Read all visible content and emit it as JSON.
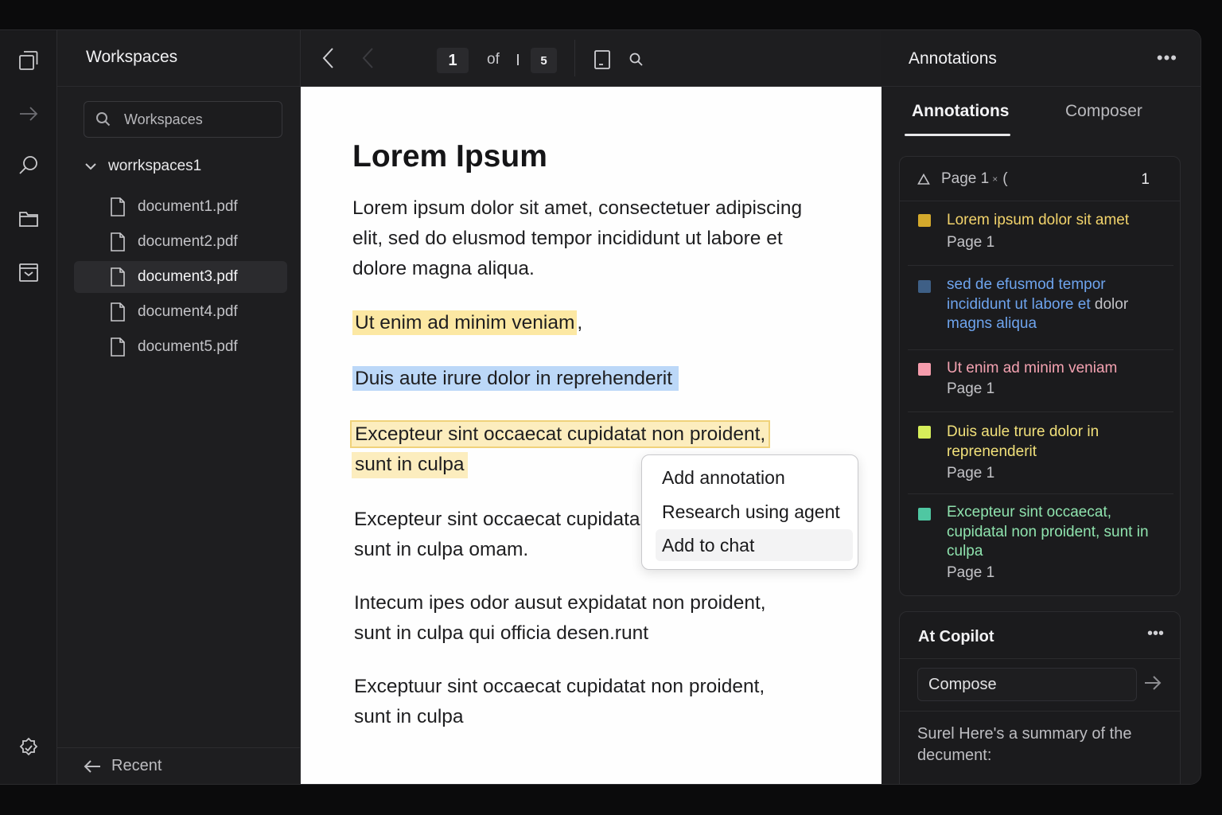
{
  "rail": {
    "icons": [
      "copy-icon",
      "arrow-right-icon",
      "search-icon",
      "folder-icon",
      "inbox-icon",
      "settings-icon"
    ]
  },
  "sidebar": {
    "title": "Workspaces",
    "search_placeholder": "Workspaces",
    "folder": "worrkspaces1",
    "files": [
      "document1.pdf",
      "document2.pdf",
      "document3.pdf",
      "document4.pdf",
      "document5.pdf"
    ],
    "active_file": "document3.pdf",
    "footer": "Recent"
  },
  "toolbar": {
    "current_page": "1",
    "of_label": "of",
    "total_pages": "5"
  },
  "document": {
    "title": "Lorem Ipsum",
    "p1": "Lorem ipsum dolor sit amet, consectetuer adipiscing elit, sed do elusmod tempor incididunt ut labore et dolore magna aliqua.",
    "hl_yellow": "Ut enim ad minim veniam",
    "hl_yellow_tail": ",",
    "hl_blue": "Duis aute irure dolor in reprehenderit",
    "hl_cream_1": "Excepteur sint occaecat cupidatat non proident,",
    "hl_cream_2": "sunt in culpa",
    "p4_line1": "Excepteur sint occaecat cupidata",
    "p4_line2": "sunt in culpa omam.",
    "p5_line1": "Intecum ipes odor ausut expidatat non proident,",
    "p5_line2": "sunt in culpa qui officia desen.runt",
    "p6_line1": "Exceptuur sint occaecat cupidatat non proident,",
    "p6_line2": "sunt in culpa"
  },
  "context_menu": {
    "items": [
      "Add annotation",
      "Research using agent",
      "Add to chat"
    ],
    "hovered": "Add to chat"
  },
  "right_panel": {
    "title": "Annotations",
    "menu_glyph": "•••",
    "tabs": [
      "Annotations",
      "Composer"
    ],
    "active_tab": "Annotations",
    "filter": {
      "label": "Page 1",
      "small": "×",
      "trail": "(",
      "count": "1"
    },
    "annotations": [
      {
        "color": "#d4a92c",
        "text": "Lorem ipsum dolor sit amet",
        "text_color": "#f2d36b",
        "page": "Page 1"
      },
      {
        "color": "#3e5f86",
        "text_a": "sed de efusmod tempor incididunt ut labore et",
        "text_b": "dolor",
        "text_c": "magns aliqua",
        "text_color": "#6ea4ee",
        "page": ""
      },
      {
        "color": "#f59cac",
        "text": "Ut enim ad minim veniam",
        "text_color": "#f4a2b1",
        "page": "Page 1"
      },
      {
        "color": "#d6ee5a",
        "text": "Duis aule trure dolor in reprenenderit",
        "text_color": "#f1e07a",
        "page": "Page 1"
      },
      {
        "color": "#4fc7a2",
        "text": "Excepteur sint occaecat, cupidatal non proident, sunt in culpa",
        "text_color": "#8fe3ae",
        "page": "Page 1"
      }
    ]
  },
  "copilot": {
    "title": "At Copilot",
    "menu_glyph": "•••",
    "compose_placeholder": "Compose",
    "message": "Surel Here's a summary of the decument:"
  }
}
